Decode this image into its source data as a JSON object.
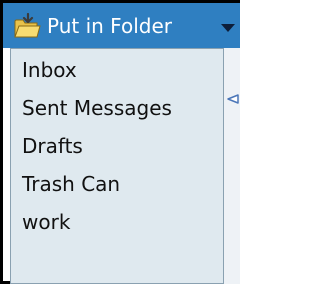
{
  "put_in_folder": {
    "label": "Put in Folder",
    "icon": "folder-open-icon",
    "dropdown_icon": "chevron-down-icon",
    "colors": {
      "button_bg": "#2f7fc1",
      "button_text": "#ffffff",
      "menu_bg": "#dfe9ef",
      "menu_border": "#8aa1b1"
    }
  },
  "folders": [
    {
      "label": "Inbox"
    },
    {
      "label": "Sent Messages"
    },
    {
      "label": "Drafts"
    },
    {
      "label": "Trash Can"
    },
    {
      "label": "work"
    }
  ]
}
